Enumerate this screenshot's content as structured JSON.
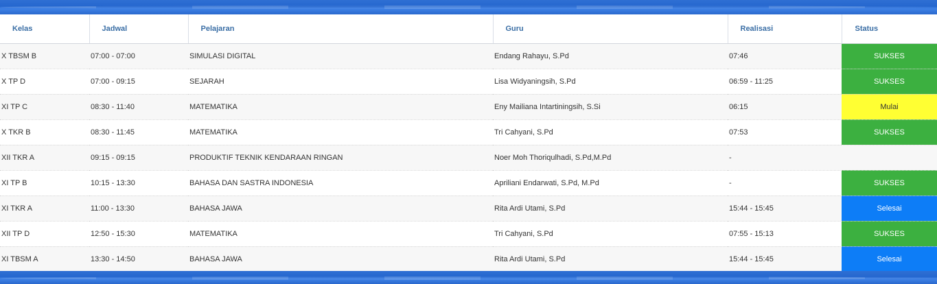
{
  "colors": {
    "header_text": "#3a6ea5",
    "band": "#2567cf",
    "sukses": "#3cb040",
    "mulai": "#ffff33",
    "selesai": "#0d7df7"
  },
  "table": {
    "headers": {
      "kelas": "Kelas",
      "jadwal": "Jadwal",
      "pelajaran": "Pelajaran",
      "guru": "Guru",
      "realisasi": "Realisasi",
      "status": "Status"
    },
    "rows": [
      {
        "kelas": "X TBSM B",
        "jadwal": "07:00 - 07:00",
        "pelajaran": "SIMULASI DIGITAL",
        "guru": "Endang Rahayu, S.Pd",
        "realisasi": "07:46",
        "status": "SUKSES",
        "status_type": "sukses"
      },
      {
        "kelas": "X TP D",
        "jadwal": "07:00 - 09:15",
        "pelajaran": "SEJARAH",
        "guru": "Lisa Widyaningsih, S.Pd",
        "realisasi": "06:59 - 11:25",
        "status": "SUKSES",
        "status_type": "sukses"
      },
      {
        "kelas": "XI TP C",
        "jadwal": "08:30 - 11:40",
        "pelajaran": "MATEMATIKA",
        "guru": "Eny Mailiana Intartiningsih, S.Si",
        "realisasi": "06:15",
        "status": "Mulai",
        "status_type": "mulai"
      },
      {
        "kelas": "X TKR B",
        "jadwal": "08:30 - 11:45",
        "pelajaran": "MATEMATIKA",
        "guru": "Tri Cahyani, S.Pd",
        "realisasi": "07:53",
        "status": "SUKSES",
        "status_type": "sukses"
      },
      {
        "kelas": "XII TKR A",
        "jadwal": "09:15 - 09:15",
        "pelajaran": "PRODUKTIF TEKNIK KENDARAAN RINGAN",
        "guru": "Noer Moh Thoriqulhadi, S.Pd,M.Pd",
        "realisasi": "-",
        "status": "",
        "status_type": "none"
      },
      {
        "kelas": "XI TP B",
        "jadwal": "10:15 - 13:30",
        "pelajaran": "BAHASA DAN SASTRA INDONESIA",
        "guru": "Apriliani Endarwati, S.Pd, M.Pd",
        "realisasi": "-",
        "status": "SUKSES",
        "status_type": "sukses"
      },
      {
        "kelas": "XI TKR A",
        "jadwal": "11:00 - 13:30",
        "pelajaran": "BAHASA JAWA",
        "guru": "Rita Ardi Utami, S.Pd",
        "realisasi": "15:44 - 15:45",
        "status": "Selesai",
        "status_type": "selesai"
      },
      {
        "kelas": "XII TP D",
        "jadwal": "12:50 - 15:30",
        "pelajaran": "MATEMATIKA",
        "guru": "Tri Cahyani, S.Pd",
        "realisasi": "07:55 - 15:13",
        "status": "SUKSES",
        "status_type": "sukses"
      },
      {
        "kelas": "XI TBSM A",
        "jadwal": "13:30 - 14:50",
        "pelajaran": "BAHASA JAWA",
        "guru": "Rita Ardi Utami, S.Pd",
        "realisasi": "15:44 - 15:45",
        "status": "Selesai",
        "status_type": "selesai"
      }
    ]
  }
}
